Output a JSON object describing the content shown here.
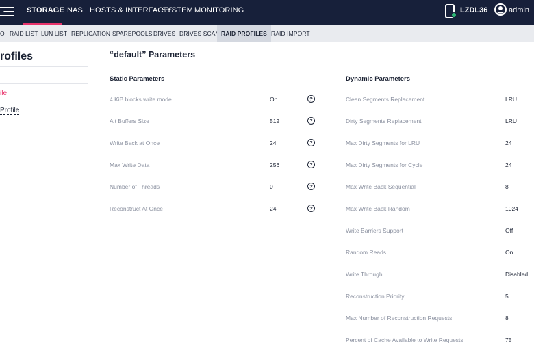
{
  "topbar": {
    "nav": [
      {
        "label": "STORAGE",
        "active": true
      },
      {
        "label": "NAS",
        "active": false
      },
      {
        "label": "HOSTS & INTERFACES",
        "active": false
      },
      {
        "label": "SYSTEM",
        "active": false
      },
      {
        "label": "MONITORING",
        "active": false
      }
    ],
    "device_name": "LZDL36",
    "device_status_color": "#2bb673",
    "user_name": "admin",
    "accent_color": "#e8336b",
    "bg_color": "#17203a"
  },
  "subnav": {
    "items": [
      {
        "label": "O",
        "active": false
      },
      {
        "label": "RAID LIST",
        "active": false
      },
      {
        "label": "LUN LIST",
        "active": false
      },
      {
        "label": "REPLICATION",
        "active": false
      },
      {
        "label": "SPAREPOOLS",
        "active": false
      },
      {
        "label": "DRIVES",
        "active": false
      },
      {
        "label": "DRIVES SCAN",
        "active": false
      },
      {
        "label": "RAID PROFILES",
        "active": true
      },
      {
        "label": "RAID IMPORT",
        "active": false
      }
    ]
  },
  "left_panel": {
    "title": "rofiles",
    "links": [
      "ile",
      "Profile"
    ]
  },
  "main": {
    "title": "“default” Parameters",
    "static": {
      "title": "Static Parameters",
      "rows": [
        {
          "label": "4 KiB blocks write mode",
          "value": "On"
        },
        {
          "label": "Alt Buffers Size",
          "value": "512"
        },
        {
          "label": "Write Back at Once",
          "value": "24"
        },
        {
          "label": "Max Write Data",
          "value": "256"
        },
        {
          "label": "Number of Threads",
          "value": "0"
        },
        {
          "label": "Reconstruct At Once",
          "value": "24"
        }
      ]
    },
    "dynamic": {
      "title": "Dynamic Parameters",
      "rows": [
        {
          "label": "Clean Segments Replacement",
          "value": "LRU"
        },
        {
          "label": "Dirty Segments Replacement",
          "value": "LRU"
        },
        {
          "label": "Max Dirty Segments for LRU",
          "value": "24"
        },
        {
          "label": "Max Dirty Segments for Cycle",
          "value": "24"
        },
        {
          "label": "Max Write Back Sequential",
          "value": "8"
        },
        {
          "label": "Max Write Back Random",
          "value": "1024"
        },
        {
          "label": "Write Barriers Support",
          "value": "Off"
        },
        {
          "label": "Random Reads",
          "value": "On"
        },
        {
          "label": "Write Through",
          "value": "Disabled"
        },
        {
          "label": "Reconstruction Priority",
          "value": "5"
        },
        {
          "label": "Max Number of Reconstruction Requests",
          "value": "8"
        },
        {
          "label": "Percent of Cache Available to Write Requests",
          "value": "75"
        }
      ]
    },
    "help_glyph": "?"
  }
}
